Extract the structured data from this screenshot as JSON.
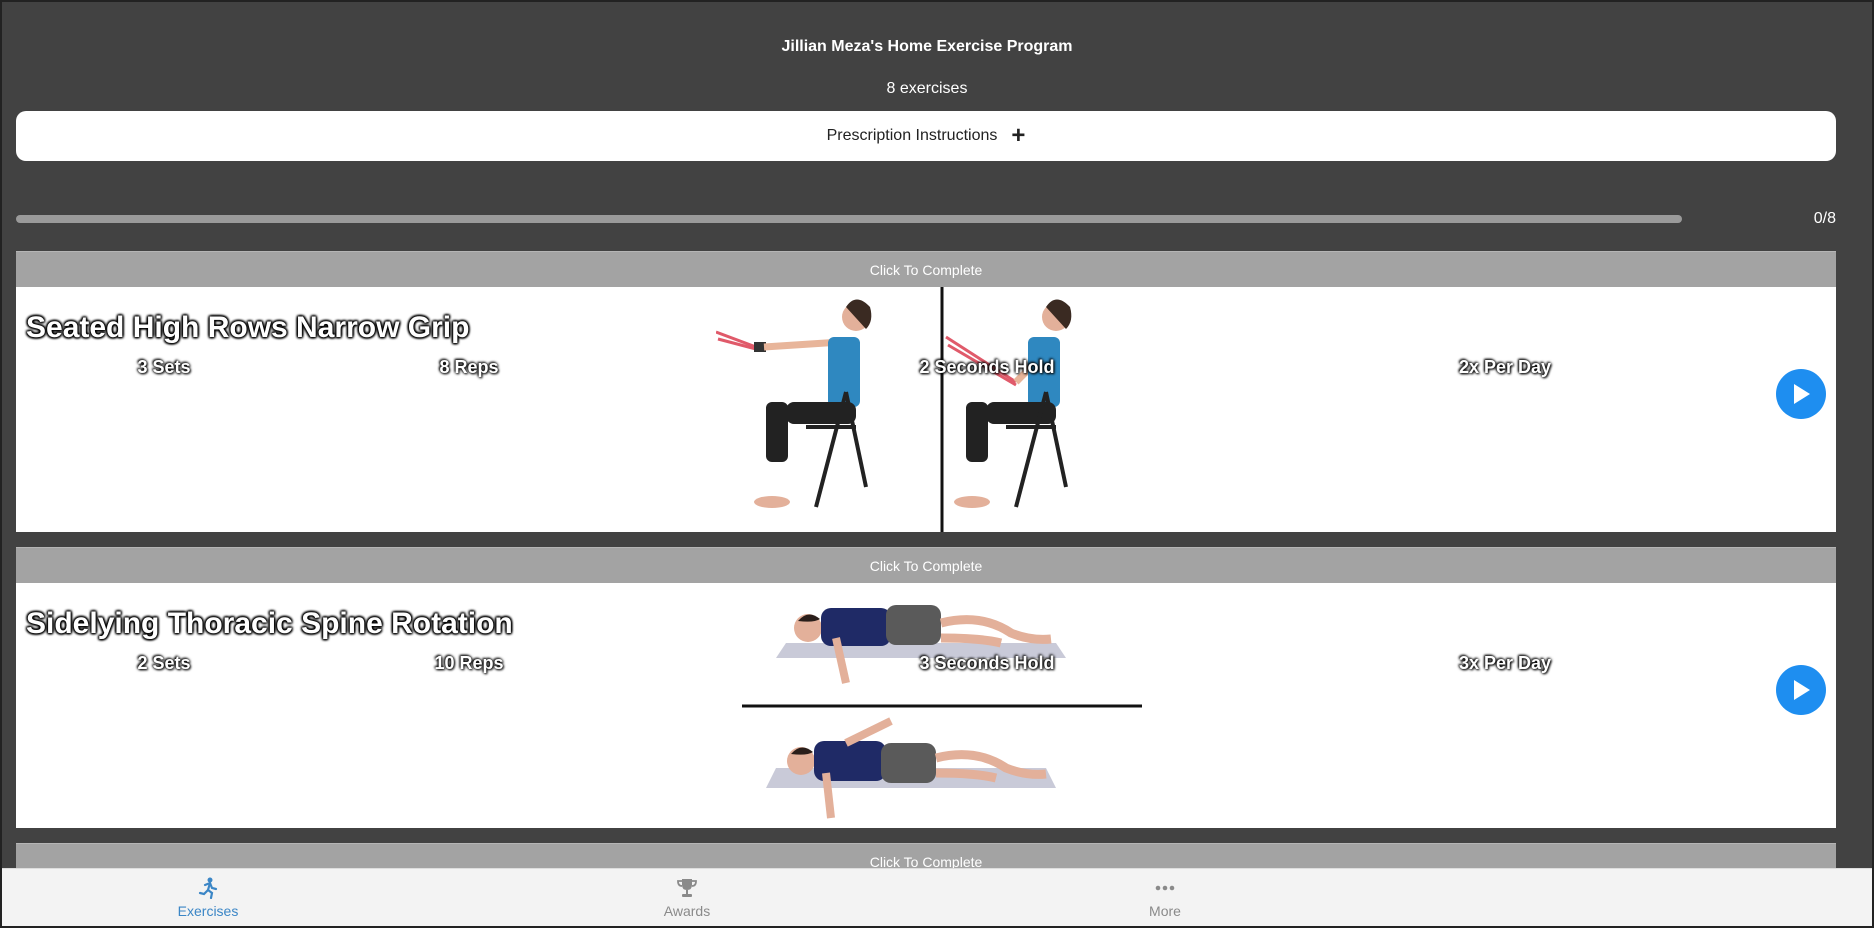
{
  "header": {
    "title": "Jillian Meza's Home Exercise Program",
    "exercise_count": "8 exercises"
  },
  "prescription": {
    "label": "Prescription Instructions",
    "toggle_glyph": "+"
  },
  "progress": {
    "text": "0/8",
    "fraction": 0
  },
  "exercises": [
    {
      "complete_label": "Click To Complete",
      "title": "Seated High Rows Narrow Grip",
      "sets": "3 Sets",
      "reps": "8 Reps",
      "hold": "2 Seconds Hold",
      "frequency": "2x Per Day",
      "play_icon": "play-icon"
    },
    {
      "complete_label": "Click To Complete",
      "title": "Sidelying Thoracic Spine Rotation",
      "sets": "2 Sets",
      "reps": "10 Reps",
      "hold": "3 Seconds Hold",
      "frequency": "3x Per Day",
      "play_icon": "play-icon"
    },
    {
      "complete_label": "Click To Complete"
    }
  ],
  "tabbar": {
    "tabs": [
      {
        "label": "Exercises",
        "icon": "running-person-icon",
        "active": true
      },
      {
        "label": "Awards",
        "icon": "trophy-icon",
        "active": false
      },
      {
        "label": "More",
        "icon": "ellipsis-icon",
        "active": false
      }
    ]
  },
  "colors": {
    "background": "#424242",
    "complete_bar": "#a3a3a3",
    "play_button": "#1e8ef0",
    "active_tab": "#3b86c6"
  }
}
